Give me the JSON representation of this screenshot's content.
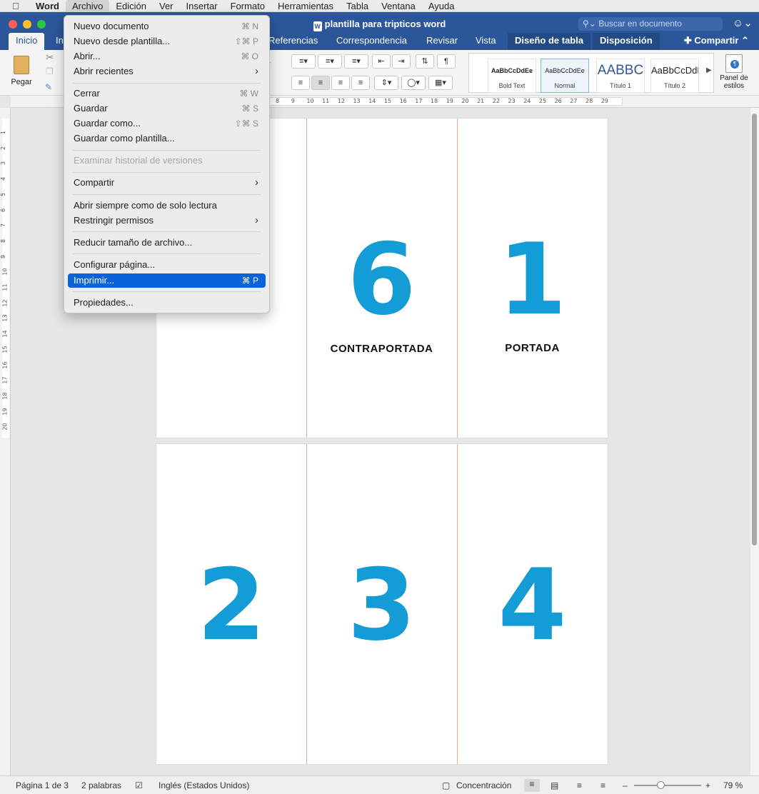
{
  "macbar": {
    "app": "Word",
    "menus": [
      "Archivo",
      "Edición",
      "Ver",
      "Insertar",
      "Formato",
      "Herramientas",
      "Tabla",
      "Ventana",
      "Ayuda"
    ]
  },
  "window": {
    "title": "plantilla para tripticos word",
    "search_placeholder": "Buscar en documento",
    "share_label": "Compartir"
  },
  "ribbon": {
    "tabs": [
      "Inicio",
      "In",
      "Referencias",
      "Correspondencia",
      "Revisar",
      "Vista",
      "Diseño de tabla",
      "Disposición"
    ],
    "paste_label": "Pegar",
    "styles": [
      {
        "sample": "AaBbCcDdEe",
        "name": "Bold Text"
      },
      {
        "sample": "AaBbCcDdEe",
        "name": "Normal"
      },
      {
        "sample": "AABBC",
        "name": "Título 1"
      },
      {
        "sample": "AaBbCcDdI",
        "name": "Título 2"
      }
    ],
    "styles_pane_label": "Panel de estilos"
  },
  "ruler": {
    "h_ticks": [
      "8",
      "9",
      "10",
      "11",
      "12",
      "13",
      "14",
      "15",
      "16",
      "17",
      "18",
      "19",
      "20",
      "21",
      "22",
      "23",
      "24",
      "25",
      "26",
      "27",
      "28",
      "29"
    ],
    "v_ticks": [
      "1",
      "2",
      "3",
      "4",
      "5",
      "6",
      "7",
      "8",
      "9",
      "10",
      "11",
      "12",
      "13",
      "14",
      "15",
      "16",
      "17",
      "18",
      "19",
      "20"
    ]
  },
  "document": {
    "page1": [
      {
        "number": "",
        "label": ""
      },
      {
        "number": "6",
        "label": "CONTRAPORTADA"
      },
      {
        "number": "1",
        "label": "PORTADA"
      }
    ],
    "page2": [
      {
        "number": "2",
        "label": ""
      },
      {
        "number": "3",
        "label": ""
      },
      {
        "number": "4",
        "label": ""
      }
    ]
  },
  "file_menu": {
    "items": [
      {
        "label": "Nuevo documento",
        "shortcut": "⌘ N"
      },
      {
        "label": "Nuevo desde plantilla...",
        "shortcut": "⇧⌘ P"
      },
      {
        "label": "Abrir...",
        "shortcut": "⌘ O"
      },
      {
        "label": "Abrir recientes",
        "shortcut": ""
      },
      {
        "label": "Cerrar",
        "shortcut": "⌘ W"
      },
      {
        "label": "Guardar",
        "shortcut": "⌘ S"
      },
      {
        "label": "Guardar como...",
        "shortcut": "⇧⌘ S"
      },
      {
        "label": "Guardar como plantilla...",
        "shortcut": ""
      },
      {
        "label": "Examinar historial de versiones",
        "shortcut": ""
      },
      {
        "label": "Compartir",
        "shortcut": ""
      },
      {
        "label": "Abrir siempre como de solo lectura",
        "shortcut": ""
      },
      {
        "label": "Restringir permisos",
        "shortcut": ""
      },
      {
        "label": "Reducir tamaño de archivo...",
        "shortcut": ""
      },
      {
        "label": "Configurar página...",
        "shortcut": ""
      },
      {
        "label": "Imprimir...",
        "shortcut": "⌘ P"
      },
      {
        "label": "Propiedades...",
        "shortcut": ""
      }
    ]
  },
  "status": {
    "page": "Página 1 de 3",
    "words": "2 palabras",
    "language": "Inglés (Estados Unidos)",
    "focus": "Concentración",
    "zoom": "79 %"
  },
  "colors": {
    "accent": "#2b579a",
    "number_blue": "#149cd6",
    "highlight": "#0b63dc"
  }
}
